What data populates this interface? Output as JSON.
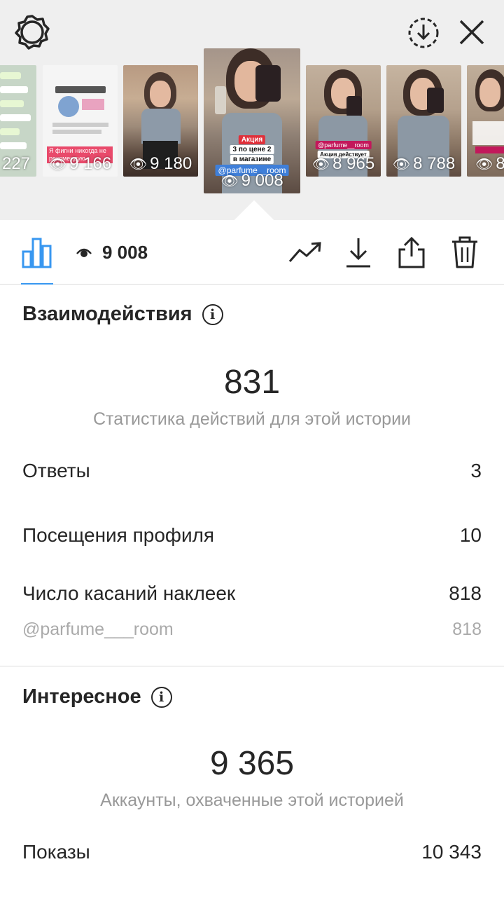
{
  "stories": [
    {
      "views": "227"
    },
    {
      "views": "9 166",
      "text": "Я фигни никогда не рекомендую"
    },
    {
      "views": "9 180"
    },
    {
      "views": "9 008",
      "stickers": [
        "Акция",
        "3 по цене 2",
        "в магазине",
        "@parfume__room"
      ]
    },
    {
      "views": "8 965",
      "stickers": [
        "@parfume__room",
        "Акция действует"
      ]
    },
    {
      "views": "8 788"
    },
    {
      "views": "8"
    }
  ],
  "toolbar": {
    "view_count": "9 008"
  },
  "interactions": {
    "title": "Взаимодействия",
    "total": "831",
    "caption": "Статистика действий для этой истории",
    "rows": [
      {
        "label": "Ответы",
        "value": "3"
      },
      {
        "label": "Посещения профиля",
        "value": "10"
      },
      {
        "label": "Число касаний наклеек",
        "value": "818"
      }
    ],
    "sub_row": {
      "label": "@parfume___room",
      "value": "818"
    }
  },
  "discovery": {
    "title": "Интересное",
    "total": "9 365",
    "caption": "Аккаунты, охваченные этой историей",
    "rows": [
      {
        "label": "Показы",
        "value": "10 343"
      }
    ]
  },
  "colors": {
    "accent": "#3897f0",
    "text": "#262626",
    "secondary": "#999999",
    "strip_bg": "#efefef"
  },
  "icons": [
    "settings-gear-icon",
    "download-circle-icon",
    "close-icon",
    "bar-chart-icon",
    "eye-icon",
    "trending-icon",
    "download-icon",
    "share-icon",
    "trash-icon",
    "info-icon"
  ]
}
